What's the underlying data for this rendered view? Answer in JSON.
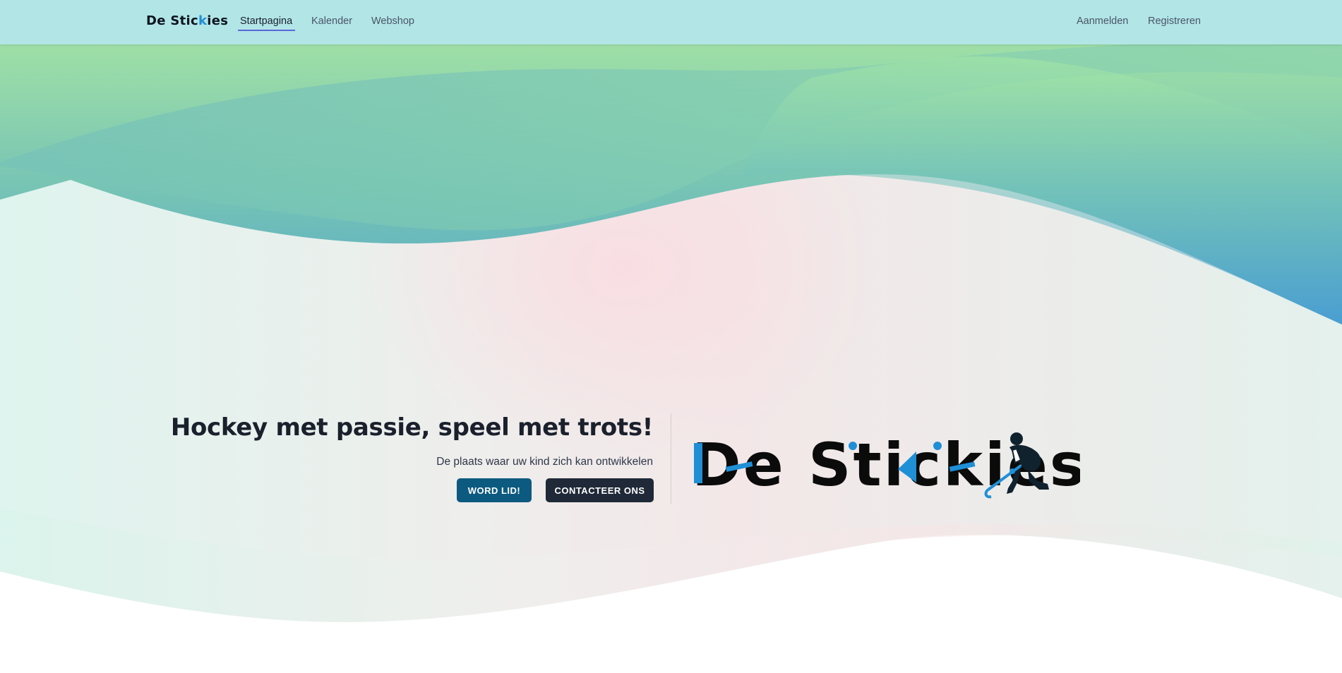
{
  "nav": {
    "brand": {
      "part1": "De Stic",
      "part2": "k",
      "part3": "ies"
    },
    "links": [
      "Startpagina",
      "Kalender",
      "Webshop"
    ],
    "active": "Startpagina",
    "auth": {
      "login": "Aanmelden",
      "register": "Registreren"
    }
  },
  "hero": {
    "title": "Hockey met passie, speel met trots!",
    "subtitle": "De plaats waar uw kind zich kan ontwikkelen",
    "primary_button": "WORD LID!",
    "secondary_button": "CONTACTEER ONS"
  },
  "logo": {
    "text": "De Stickies",
    "dark_color": "#0b0b0b",
    "accent_color": "#1f8fd6"
  },
  "colors": {
    "navbar_bg": "#b2e5e6",
    "wave_green": "#a3e4a4",
    "wave_blue": "#4a9bd6",
    "primary_button": "#0d5a80",
    "dark_button": "#1f2937"
  }
}
